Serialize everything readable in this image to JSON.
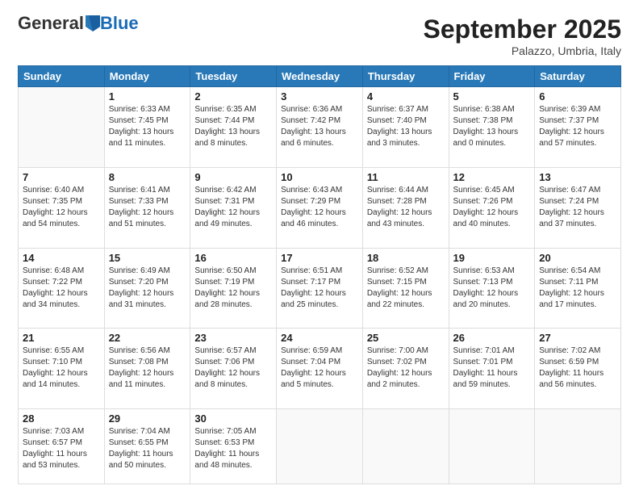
{
  "logo": {
    "general": "General",
    "blue": "Blue"
  },
  "title": "September 2025",
  "subtitle": "Palazzo, Umbria, Italy",
  "weekdays": [
    "Sunday",
    "Monday",
    "Tuesday",
    "Wednesday",
    "Thursday",
    "Friday",
    "Saturday"
  ],
  "weeks": [
    [
      {
        "day": "",
        "info": ""
      },
      {
        "day": "1",
        "info": "Sunrise: 6:33 AM\nSunset: 7:45 PM\nDaylight: 13 hours\nand 11 minutes."
      },
      {
        "day": "2",
        "info": "Sunrise: 6:35 AM\nSunset: 7:44 PM\nDaylight: 13 hours\nand 8 minutes."
      },
      {
        "day": "3",
        "info": "Sunrise: 6:36 AM\nSunset: 7:42 PM\nDaylight: 13 hours\nand 6 minutes."
      },
      {
        "day": "4",
        "info": "Sunrise: 6:37 AM\nSunset: 7:40 PM\nDaylight: 13 hours\nand 3 minutes."
      },
      {
        "day": "5",
        "info": "Sunrise: 6:38 AM\nSunset: 7:38 PM\nDaylight: 13 hours\nand 0 minutes."
      },
      {
        "day": "6",
        "info": "Sunrise: 6:39 AM\nSunset: 7:37 PM\nDaylight: 12 hours\nand 57 minutes."
      }
    ],
    [
      {
        "day": "7",
        "info": "Sunrise: 6:40 AM\nSunset: 7:35 PM\nDaylight: 12 hours\nand 54 minutes."
      },
      {
        "day": "8",
        "info": "Sunrise: 6:41 AM\nSunset: 7:33 PM\nDaylight: 12 hours\nand 51 minutes."
      },
      {
        "day": "9",
        "info": "Sunrise: 6:42 AM\nSunset: 7:31 PM\nDaylight: 12 hours\nand 49 minutes."
      },
      {
        "day": "10",
        "info": "Sunrise: 6:43 AM\nSunset: 7:29 PM\nDaylight: 12 hours\nand 46 minutes."
      },
      {
        "day": "11",
        "info": "Sunrise: 6:44 AM\nSunset: 7:28 PM\nDaylight: 12 hours\nand 43 minutes."
      },
      {
        "day": "12",
        "info": "Sunrise: 6:45 AM\nSunset: 7:26 PM\nDaylight: 12 hours\nand 40 minutes."
      },
      {
        "day": "13",
        "info": "Sunrise: 6:47 AM\nSunset: 7:24 PM\nDaylight: 12 hours\nand 37 minutes."
      }
    ],
    [
      {
        "day": "14",
        "info": "Sunrise: 6:48 AM\nSunset: 7:22 PM\nDaylight: 12 hours\nand 34 minutes."
      },
      {
        "day": "15",
        "info": "Sunrise: 6:49 AM\nSunset: 7:20 PM\nDaylight: 12 hours\nand 31 minutes."
      },
      {
        "day": "16",
        "info": "Sunrise: 6:50 AM\nSunset: 7:19 PM\nDaylight: 12 hours\nand 28 minutes."
      },
      {
        "day": "17",
        "info": "Sunrise: 6:51 AM\nSunset: 7:17 PM\nDaylight: 12 hours\nand 25 minutes."
      },
      {
        "day": "18",
        "info": "Sunrise: 6:52 AM\nSunset: 7:15 PM\nDaylight: 12 hours\nand 22 minutes."
      },
      {
        "day": "19",
        "info": "Sunrise: 6:53 AM\nSunset: 7:13 PM\nDaylight: 12 hours\nand 20 minutes."
      },
      {
        "day": "20",
        "info": "Sunrise: 6:54 AM\nSunset: 7:11 PM\nDaylight: 12 hours\nand 17 minutes."
      }
    ],
    [
      {
        "day": "21",
        "info": "Sunrise: 6:55 AM\nSunset: 7:10 PM\nDaylight: 12 hours\nand 14 minutes."
      },
      {
        "day": "22",
        "info": "Sunrise: 6:56 AM\nSunset: 7:08 PM\nDaylight: 12 hours\nand 11 minutes."
      },
      {
        "day": "23",
        "info": "Sunrise: 6:57 AM\nSunset: 7:06 PM\nDaylight: 12 hours\nand 8 minutes."
      },
      {
        "day": "24",
        "info": "Sunrise: 6:59 AM\nSunset: 7:04 PM\nDaylight: 12 hours\nand 5 minutes."
      },
      {
        "day": "25",
        "info": "Sunrise: 7:00 AM\nSunset: 7:02 PM\nDaylight: 12 hours\nand 2 minutes."
      },
      {
        "day": "26",
        "info": "Sunrise: 7:01 AM\nSunset: 7:01 PM\nDaylight: 11 hours\nand 59 minutes."
      },
      {
        "day": "27",
        "info": "Sunrise: 7:02 AM\nSunset: 6:59 PM\nDaylight: 11 hours\nand 56 minutes."
      }
    ],
    [
      {
        "day": "28",
        "info": "Sunrise: 7:03 AM\nSunset: 6:57 PM\nDaylight: 11 hours\nand 53 minutes."
      },
      {
        "day": "29",
        "info": "Sunrise: 7:04 AM\nSunset: 6:55 PM\nDaylight: 11 hours\nand 50 minutes."
      },
      {
        "day": "30",
        "info": "Sunrise: 7:05 AM\nSunset: 6:53 PM\nDaylight: 11 hours\nand 48 minutes."
      },
      {
        "day": "",
        "info": ""
      },
      {
        "day": "",
        "info": ""
      },
      {
        "day": "",
        "info": ""
      },
      {
        "day": "",
        "info": ""
      }
    ]
  ]
}
